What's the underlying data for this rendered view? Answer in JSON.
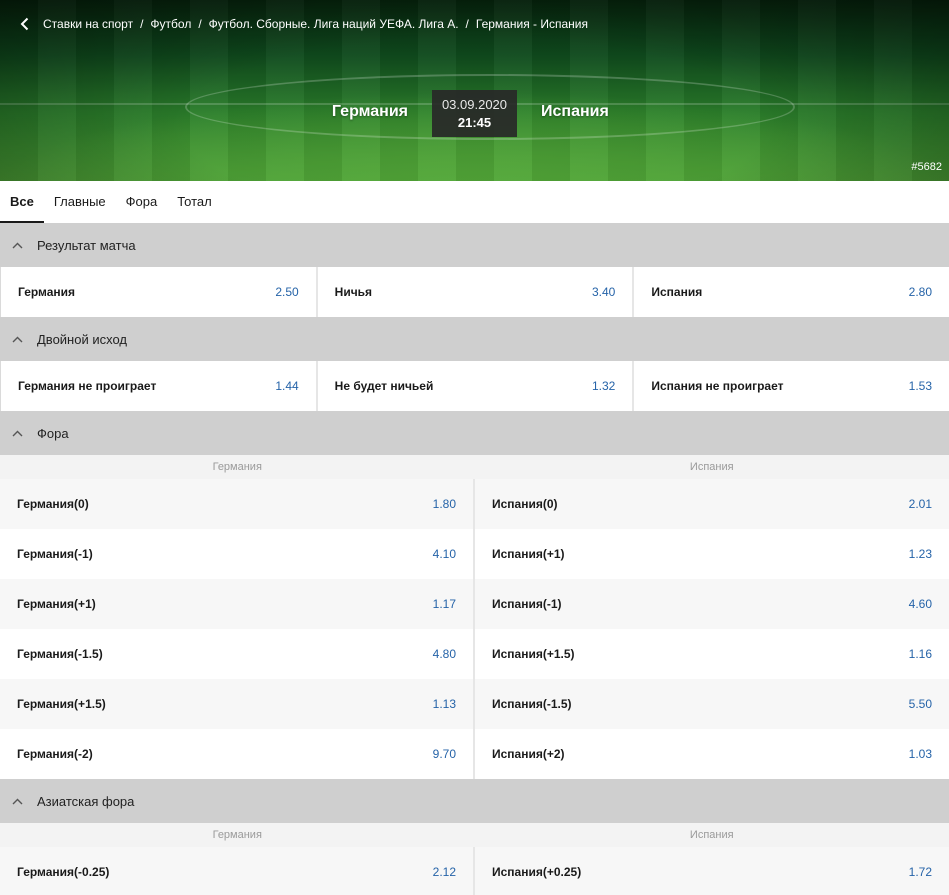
{
  "breadcrumb": [
    "Ставки на спорт",
    "Футбол",
    "Футбол. Сборные. Лига наций УЕФА. Лига А.",
    "Германия - Испания"
  ],
  "match": {
    "home": "Германия",
    "away": "Испания",
    "date": "03.09.2020",
    "time": "21:45",
    "event_id": "#5682"
  },
  "tabs": [
    "Все",
    "Главные",
    "Фора",
    "Тотал"
  ],
  "active_tab": "Все",
  "markets": {
    "result": {
      "title": "Результат матча",
      "outcomes": [
        {
          "label": "Германия",
          "odd": "2.50"
        },
        {
          "label": "Ничья",
          "odd": "3.40"
        },
        {
          "label": "Испания",
          "odd": "2.80"
        }
      ]
    },
    "double": {
      "title": "Двойной исход",
      "outcomes": [
        {
          "label": "Германия не проиграет",
          "odd": "1.44"
        },
        {
          "label": "Не будет ничьей",
          "odd": "1.32"
        },
        {
          "label": "Испания не проиграет",
          "odd": "1.53"
        }
      ]
    },
    "handicap": {
      "title": "Фора",
      "col_home": "Германия",
      "col_away": "Испания",
      "rows": [
        {
          "home_label": "Германия(0)",
          "home_odd": "1.80",
          "away_label": "Испания(0)",
          "away_odd": "2.01"
        },
        {
          "home_label": "Германия(-1)",
          "home_odd": "4.10",
          "away_label": "Испания(+1)",
          "away_odd": "1.23"
        },
        {
          "home_label": "Германия(+1)",
          "home_odd": "1.17",
          "away_label": "Испания(-1)",
          "away_odd": "4.60"
        },
        {
          "home_label": "Германия(-1.5)",
          "home_odd": "4.80",
          "away_label": "Испания(+1.5)",
          "away_odd": "1.16"
        },
        {
          "home_label": "Германия(+1.5)",
          "home_odd": "1.13",
          "away_label": "Испания(-1.5)",
          "away_odd": "5.50"
        },
        {
          "home_label": "Германия(-2)",
          "home_odd": "9.70",
          "away_label": "Испания(+2)",
          "away_odd": "1.03"
        }
      ]
    },
    "asian": {
      "title": "Азиатская фора",
      "col_home": "Германия",
      "col_away": "Испания",
      "rows": [
        {
          "home_label": "Германия(-0.25)",
          "home_odd": "2.12",
          "away_label": "Испания(+0.25)",
          "away_odd": "1.72"
        }
      ]
    }
  },
  "colors": {
    "odd": "#2563a8",
    "section_bg": "#cfcfcf"
  }
}
